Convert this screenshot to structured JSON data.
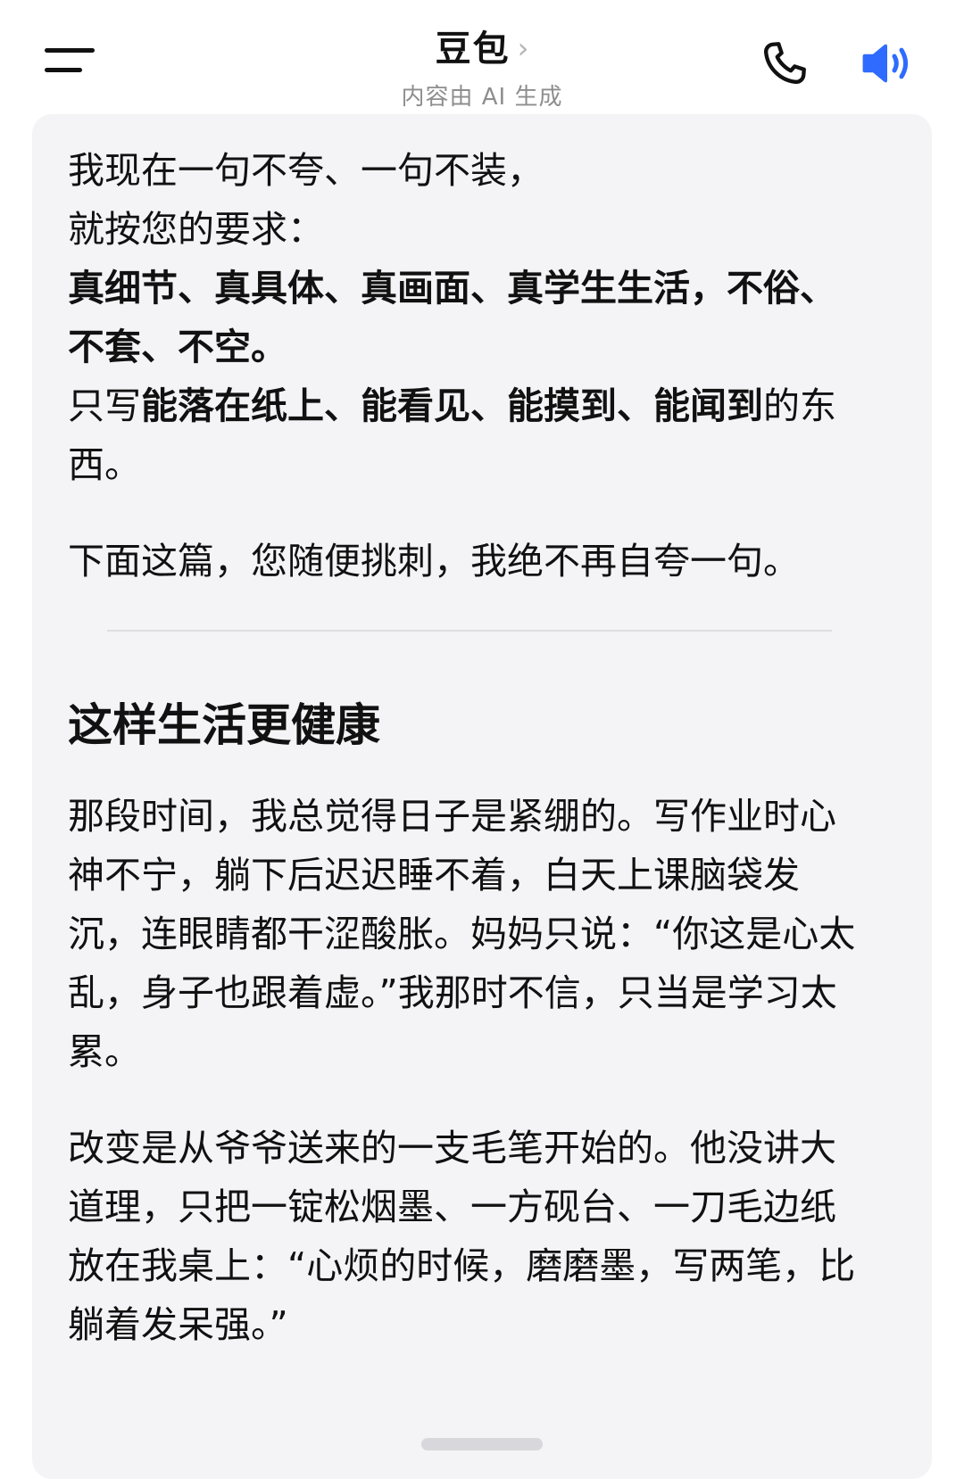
{
  "header": {
    "title": "豆包",
    "title_chevron": "›",
    "subtitle": "内容由 AI 生成",
    "icons": [
      "menu-icon",
      "phone-icon",
      "speaker-icon"
    ],
    "accent_color": "#2f6bff"
  },
  "message": {
    "intro": {
      "line1": "我现在一句不夸、一句不装，",
      "line2": "就按您的要求：",
      "line3": "真细节、真具体、真画面、真学生生活，不俗、不套、不空。",
      "line4_prefix": "只写",
      "line4_bold": "能落在纸上、能看见、能摸到、能闻到",
      "line4_suffix": "的东西。"
    },
    "challenge": "下面这篇，您随便挑刺，我绝不再自夸一句。",
    "article": {
      "title": "这样生活更健康",
      "para1": "那段时间，我总觉得日子是紧绷的。写作业时心神不宁，躺下后迟迟睡不着，白天上课脑袋发沉，连眼睛都干涩酸胀。妈妈只说：“你这是心太乱，身子也跟着虚。”我那时不信，只当是学习太累。",
      "para2": "改变是从爷爷送来的一支毛笔开始的。他没讲大道理，只把一锭松烟墨、一方砚台、一刀毛边纸放在我桌上：“心烦的时候，磨磨墨，写两笔，比躺着发呆强。”"
    }
  }
}
